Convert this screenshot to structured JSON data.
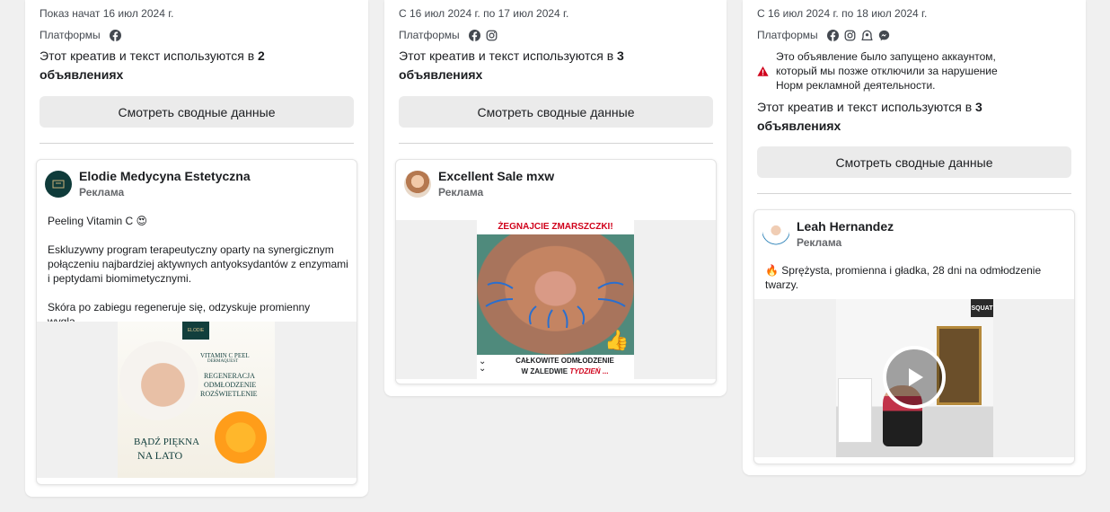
{
  "cards": [
    {
      "date_text": "Показ начат 16 июл 2024 г.",
      "platforms_label": "Платформы",
      "usage_prefix": "Этот креатив и текст используются в ",
      "usage_count": "2",
      "usage_suffix": "объявлениях",
      "button_label": "Смотреть сводные данные",
      "ad": {
        "page_name": "Elodie Medycyna Estetyczna",
        "sponsored": "Реклама",
        "text": "Peeling Vitamin C 😍\n\nEskluzywny program terapeutyczny oparty na synergicznym połączeniu najbardziej aktywnych antyoksydantów z enzymami i peptydami biomimetycznymi.\n\nSkóra po zabiegu regeneruje się, odzyskuje promienny wyglą…",
        "image": {
          "brand": "ELODIE",
          "line1": "VITAMIN C PEEL",
          "line2": "DERMAQUEST",
          "headline1": "REGENERACJA",
          "headline2": "ODMŁODZENIE",
          "headline3": "ROZŚWIETLENIE",
          "footer1": "BĄDŹ PIĘKNA",
          "footer2": "NA LATO"
        }
      }
    },
    {
      "date_text": "С 16 июл 2024 г. по 17 июл 2024 г.",
      "platforms_label": "Платформы",
      "usage_prefix": "Этот креатив и текст используются в ",
      "usage_count": "3",
      "usage_suffix": "объявлениях",
      "button_label": "Смотреть сводные данные",
      "ad": {
        "page_name": "Excellent Sale mxw",
        "sponsored": "Реклама",
        "image": {
          "top_text": "ŻEGNAJCIE ZMARSZCZKI!",
          "bottom1": "CAŁKOWITE ODMŁODZENIE",
          "bottom2a": "W ZALEDWIE ",
          "bottom2b": "TYDZIEŃ",
          "bottom2c": " ..."
        }
      }
    },
    {
      "date_text": "С 16 июл 2024 г. по 18 июл 2024 г.",
      "platforms_label": "Платформы",
      "warning": "Это объявление было запущено аккаунтом, который мы позже отключили за нарушение Норм рекламной деятельности.",
      "usage_prefix": "Этот креатив и текст используются в ",
      "usage_count": "3",
      "usage_suffix": "объявлениях",
      "button_label": "Смотреть сводные данные",
      "ad": {
        "page_name": "Leah Hernandez",
        "sponsored": "Реклама",
        "text": "🔥 Sprężysta, promienna i gładka, 28 dni na odmłodzenie twarzy.",
        "image": {
          "sign": "SQUAT"
        }
      }
    }
  ],
  "colors": {
    "facebook": "#1c1e21",
    "warning": "#d0021b",
    "background": "#f0f0f0"
  },
  "icons": [
    "facebook-icon",
    "instagram-icon",
    "audience-network-icon",
    "messenger-icon",
    "warning-icon",
    "play-icon"
  ]
}
